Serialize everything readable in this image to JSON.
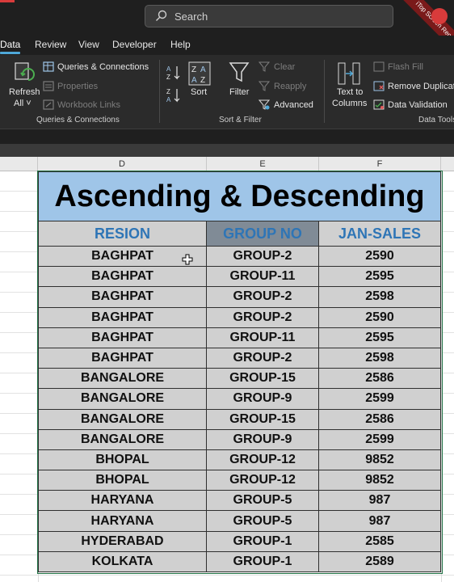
{
  "titlebar": {
    "search_placeholder": "Search",
    "watermark": "iTop Screen Recorder"
  },
  "tabs": [
    {
      "label": "Data",
      "active": true
    },
    {
      "label": "Review",
      "active": false
    },
    {
      "label": "View",
      "active": false
    },
    {
      "label": "Developer",
      "active": false
    },
    {
      "label": "Help",
      "active": false
    }
  ],
  "ribbon": {
    "refresh_label": "Refresh",
    "refresh_all_label": "All ˅",
    "queries_connections": "Queries & Connections",
    "properties": "Properties",
    "workbook_links": "Workbook Links",
    "group_queries": "Queries & Connections",
    "sort_label": "Sort",
    "filter_label": "Filter",
    "clear": "Clear",
    "reapply": "Reapply",
    "advanced": "Advanced",
    "group_sort_filter": "Sort & Filter",
    "text_to": "Text to",
    "columns": "Columns",
    "flash_fill": "Flash Fill",
    "remove_duplicates": "Remove Duplicates",
    "data_validation": "Data Validation",
    "group_data_tools": "Data Tools"
  },
  "columns": [
    "D",
    "E",
    "F"
  ],
  "sheet": {
    "title": "Ascending & Descending",
    "headers": [
      "RESION",
      "GROUP NO",
      "JAN-SALES"
    ],
    "rows": [
      [
        "BAGHPAT",
        "GROUP-2",
        "2590"
      ],
      [
        "BAGHPAT",
        "GROUP-11",
        "2595"
      ],
      [
        "BAGHPAT",
        "GROUP-2",
        "2598"
      ],
      [
        "BAGHPAT",
        "GROUP-2",
        "2590"
      ],
      [
        "BAGHPAT",
        "GROUP-11",
        "2595"
      ],
      [
        "BAGHPAT",
        "GROUP-2",
        "2598"
      ],
      [
        "BANGALORE",
        "GROUP-15",
        "2586"
      ],
      [
        "BANGALORE",
        "GROUP-9",
        "2599"
      ],
      [
        "BANGALORE",
        "GROUP-15",
        "2586"
      ],
      [
        "BANGALORE",
        "GROUP-9",
        "2599"
      ],
      [
        "BHOPAL",
        "GROUP-12",
        "9852"
      ],
      [
        "BHOPAL",
        "GROUP-12",
        "9852"
      ],
      [
        "HARYANA",
        "GROUP-5",
        "987"
      ],
      [
        "HARYANA",
        "GROUP-5",
        "987"
      ],
      [
        "HYDERABAD",
        "GROUP-1",
        "2585"
      ],
      [
        "KOLKATA",
        "GROUP-1",
        "2589"
      ]
    ]
  }
}
